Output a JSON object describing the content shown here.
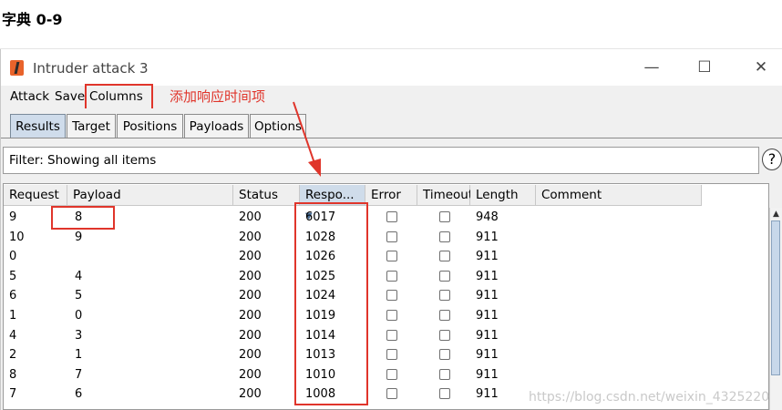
{
  "heading": "字典 0-9",
  "window": {
    "title": "Intruder attack 3",
    "minimize_glyph": "—",
    "maximize_glyph": "☐",
    "close_glyph": "✕"
  },
  "menubar": {
    "items": [
      "Attack",
      "Save",
      "Columns"
    ]
  },
  "annotation": {
    "text": "添加响应时间项",
    "color": "#e0352b"
  },
  "tabs": [
    "Results",
    "Target",
    "Positions",
    "Payloads",
    "Options"
  ],
  "active_tab": "Results",
  "filter": {
    "label": "Filter: Showing all items",
    "help_glyph": "?"
  },
  "table": {
    "columns": [
      "Request",
      "Payload",
      "Status",
      "Respo...",
      "Error",
      "Timeout",
      "Length",
      "Comment"
    ],
    "sort_indicator": "▼",
    "rows": [
      {
        "request": "9",
        "payload": "8",
        "status": "200",
        "response": "6017",
        "error": false,
        "timeout": false,
        "length": "948",
        "comment": ""
      },
      {
        "request": "10",
        "payload": "9",
        "status": "200",
        "response": "1028",
        "error": false,
        "timeout": false,
        "length": "911",
        "comment": ""
      },
      {
        "request": "0",
        "payload": "",
        "status": "200",
        "response": "1026",
        "error": false,
        "timeout": false,
        "length": "911",
        "comment": ""
      },
      {
        "request": "5",
        "payload": "4",
        "status": "200",
        "response": "1025",
        "error": false,
        "timeout": false,
        "length": "911",
        "comment": ""
      },
      {
        "request": "6",
        "payload": "5",
        "status": "200",
        "response": "1024",
        "error": false,
        "timeout": false,
        "length": "911",
        "comment": ""
      },
      {
        "request": "1",
        "payload": "0",
        "status": "200",
        "response": "1019",
        "error": false,
        "timeout": false,
        "length": "911",
        "comment": ""
      },
      {
        "request": "4",
        "payload": "3",
        "status": "200",
        "response": "1014",
        "error": false,
        "timeout": false,
        "length": "911",
        "comment": ""
      },
      {
        "request": "2",
        "payload": "1",
        "status": "200",
        "response": "1013",
        "error": false,
        "timeout": false,
        "length": "911",
        "comment": ""
      },
      {
        "request": "8",
        "payload": "7",
        "status": "200",
        "response": "1010",
        "error": false,
        "timeout": false,
        "length": "911",
        "comment": ""
      },
      {
        "request": "7",
        "payload": "6",
        "status": "200",
        "response": "1008",
        "error": false,
        "timeout": false,
        "length": "911",
        "comment": ""
      }
    ]
  },
  "scrollbar": {
    "up_glyph": "▲"
  },
  "watermark": "https://blog.csdn.net/weixin_4325220",
  "colors": {
    "highlight_red": "#e0352b",
    "active_tab": "#cfdceb",
    "sorted_header": "#cfdcea",
    "app_icon": "#e8632b"
  }
}
